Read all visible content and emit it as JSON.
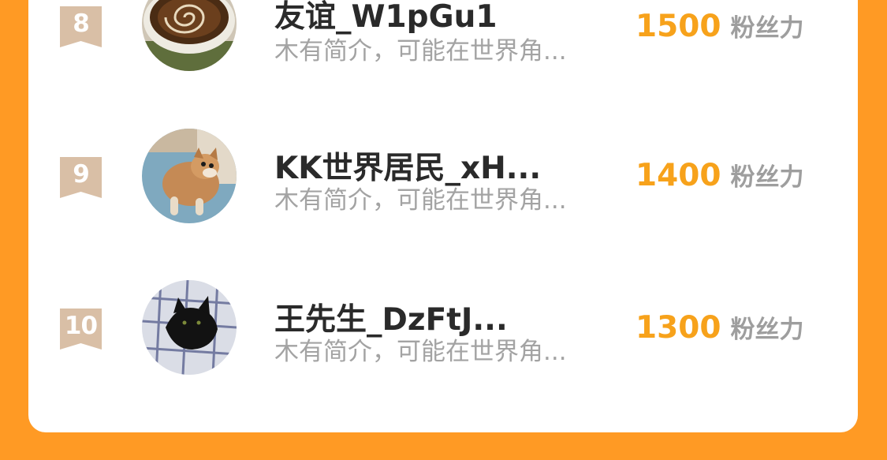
{
  "colors": {
    "background": "#FF9A24",
    "card": "#FFFFFF",
    "badge": "#D9BFA6",
    "name": "#2A2A2A",
    "bio": "#A3A3A3",
    "score": "#F7A21B",
    "unit": "#9E9E9E"
  },
  "ranking": {
    "items": [
      {
        "rank": "8",
        "name": "友谊_W1pGu1",
        "bio": "木有简介，可能在世界角...",
        "score": "1500",
        "unit": "粉丝力",
        "avatar_icon": "coffee-cup-avatar"
      },
      {
        "rank": "9",
        "name": "KK世界居民_xH...",
        "bio": "木有简介，可能在世界角...",
        "score": "1400",
        "unit": "粉丝力",
        "avatar_icon": "puppy-avatar"
      },
      {
        "rank": "10",
        "name": "王先生_DzFtJ...",
        "bio": "木有简介，可能在世界角...",
        "score": "1300",
        "unit": "粉丝力",
        "avatar_icon": "black-cat-avatar"
      }
    ]
  }
}
